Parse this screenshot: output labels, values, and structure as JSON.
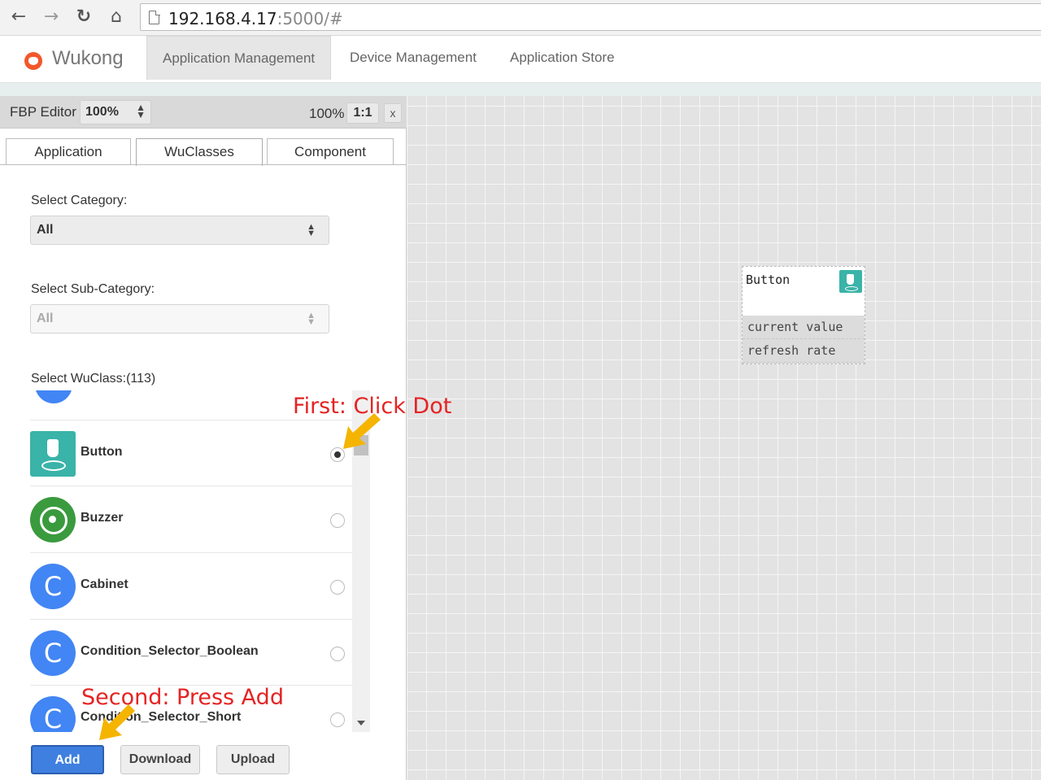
{
  "browser": {
    "url_host": "192.168.4.17",
    "url_path": ":5000/#",
    "back_icon": "back-arrow-icon",
    "forward_icon": "forward-arrow-icon",
    "reload_icon": "reload-icon",
    "home_icon": "home-icon"
  },
  "navbar": {
    "brand": "Wukong",
    "items": [
      {
        "label": "Application Management",
        "active": true
      },
      {
        "label": "Device Management",
        "active": false
      },
      {
        "label": "Application Store",
        "active": false
      }
    ]
  },
  "panel": {
    "title": "FBP Editor",
    "zoom_select": "100%",
    "zoom_readout": "100%",
    "ratio_button": "1:1",
    "close_button": "x",
    "tabs": [
      {
        "label": "Application",
        "active": false
      },
      {
        "label": "WuClasses",
        "active": true
      },
      {
        "label": "Component",
        "active": false
      }
    ],
    "category_label": "Select Category:",
    "category_value": "All",
    "subcategory_label": "Select Sub-Category:",
    "subcategory_value": "All",
    "wuclass_label": "Select WuClass:(113)",
    "classes": [
      {
        "name": "Button",
        "icon": "button-press-icon",
        "selected": true
      },
      {
        "name": "Buzzer",
        "icon": "buzzer-icon",
        "selected": false
      },
      {
        "name": "Cabinet",
        "icon": "letter-c-icon",
        "letter": "C",
        "selected": false
      },
      {
        "name": "Condition_Selector_Boolean",
        "icon": "letter-c-icon",
        "letter": "C",
        "selected": false
      },
      {
        "name": "Condition_Selector_Short",
        "icon": "letter-c-icon",
        "letter": "C",
        "selected": false
      }
    ],
    "buttons": {
      "add": "Add",
      "download": "Download",
      "upload": "Upload"
    }
  },
  "canvas": {
    "component": {
      "title": "Button",
      "icon": "button-press-icon",
      "properties": [
        "current value",
        "refresh rate"
      ]
    }
  },
  "annotations": {
    "first": "First: Click Dot",
    "second": "Second: Press Add",
    "color": "#e52323",
    "arrow_color": "#f5b400"
  }
}
